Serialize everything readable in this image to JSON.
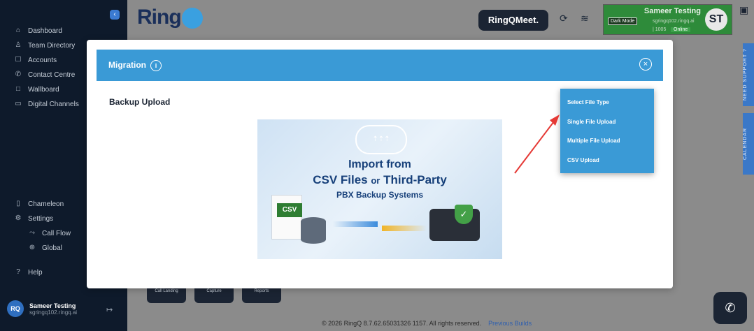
{
  "sidebar": {
    "items": [
      {
        "label": "Dashboard",
        "icon": "home-icon"
      },
      {
        "label": "Team Directory",
        "icon": "user-icon"
      },
      {
        "label": "Accounts",
        "icon": "accounts-icon"
      },
      {
        "label": "Contact Centre",
        "icon": "phone-icon"
      },
      {
        "label": "Wallboard",
        "icon": "square-icon"
      },
      {
        "label": "Digital Channels",
        "icon": "chat-icon"
      }
    ],
    "lower_items": [
      {
        "label": "Chameleon",
        "icon": "device-icon"
      },
      {
        "label": "Settings",
        "icon": "gear-icon"
      }
    ],
    "sub_items": [
      {
        "label": "Call Flow",
        "icon": "flow-icon"
      },
      {
        "label": "Global",
        "icon": "globe-icon"
      }
    ],
    "help": "Help",
    "user": {
      "initials": "RQ",
      "name": "Sameer Testing",
      "email": "sgringq102.ringq.ai"
    }
  },
  "topbar": {
    "logo": "Ring",
    "meet": "RingQMeet.",
    "profile": {
      "name": "Sameer Testing",
      "dark_mode": "Dark Mode",
      "email": "sgringq102.ringq.ai",
      "ext": "| 1005",
      "status": "Online",
      "initials": "ST"
    }
  },
  "side_tabs": {
    "support": "NEED SUPPORT ?",
    "calendar": "CALENDAR"
  },
  "background_buttons": [
    "Call Landing",
    "Capture",
    "Reports"
  ],
  "footer": {
    "text": "© 2026 RingQ 8.7.62.65031326 1157. All rights reserved.",
    "link": "Previous Builds"
  },
  "modal": {
    "title": "Migration",
    "section_title": "Backup Upload",
    "banner": {
      "line1": "Import from",
      "line2a": "CSV Files",
      "line2b": "or",
      "line2c": "Third-Party",
      "line3": "PBX Backup Systems",
      "csv_tag": "CSV"
    }
  },
  "dropdown": {
    "options": [
      "Select File Type",
      "Single File Upload",
      "Multiple File Upload",
      "CSV Upload"
    ]
  },
  "colors": {
    "accent": "#3a9ad6",
    "sidebar": "#0e1a2b",
    "profile": "#2e8b3a",
    "arrow": "#e53935"
  }
}
